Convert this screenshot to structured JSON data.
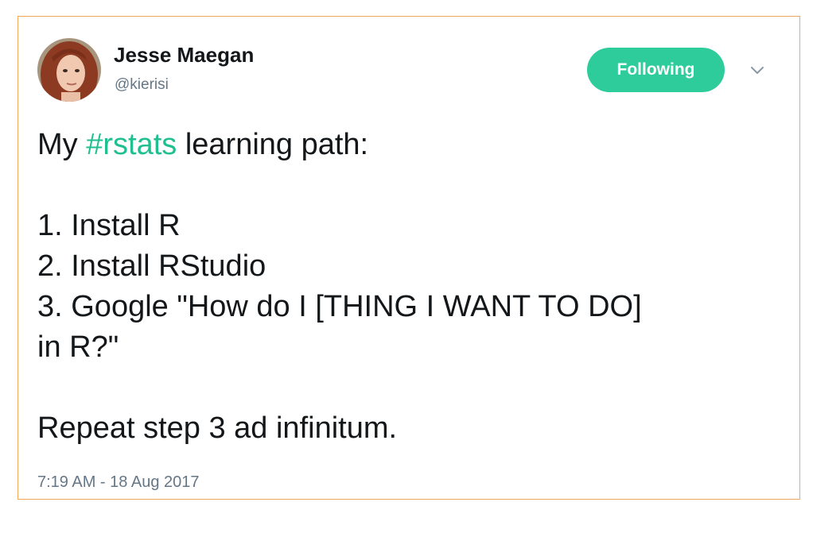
{
  "tweet": {
    "author": {
      "display_name": "Jesse Maegan",
      "handle": "@kierisi"
    },
    "follow_button_label": "Following",
    "text": {
      "prefix": "My ",
      "hashtag": "#rstats",
      "suffix": " learning path:",
      "steps": [
        "1. Install R",
        "2. Install RStudio",
        "3. Google \"How do I [THING I WANT TO DO]",
        "in R?\""
      ],
      "closing": "Repeat step 3 ad infinitum."
    },
    "timestamp": "7:19 AM - 18 Aug 2017"
  },
  "colors": {
    "accent": "#2ecc9a",
    "hashtag": "#1fbf8f",
    "card_border": "#f2a65a",
    "meta_text": "#657786"
  },
  "icons": {
    "avatar": "profile-photo",
    "caret": "chevron-down-icon"
  }
}
